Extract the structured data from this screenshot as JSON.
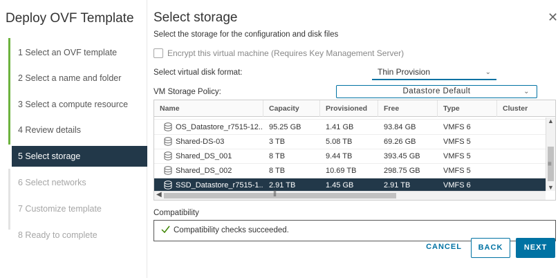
{
  "wizard": {
    "title": "Deploy OVF Template",
    "steps": [
      {
        "label": "1  Select an OVF template",
        "state": "done"
      },
      {
        "label": "2  Select a name and folder",
        "state": "done"
      },
      {
        "label": "3  Select a compute resource",
        "state": "done"
      },
      {
        "label": "4  Review details",
        "state": "done"
      },
      {
        "label": "5  Select storage",
        "state": "active"
      },
      {
        "label": "6  Select networks",
        "state": "disabled"
      },
      {
        "label": "7  Customize template",
        "state": "disabled"
      },
      {
        "label": "8  Ready to complete",
        "state": "disabled"
      }
    ]
  },
  "page": {
    "title": "Select storage",
    "subtitle": "Select the storage for the configuration and disk files",
    "close_icon": "close-icon"
  },
  "encrypt": {
    "label": "Encrypt this virtual machine (Requires Key Management Server)",
    "checked": false
  },
  "disk_format": {
    "label": "Select virtual disk format:",
    "value": "Thin Provision"
  },
  "storage_policy": {
    "label": "VM Storage Policy:",
    "value": "Datastore Default"
  },
  "grid": {
    "columns": [
      "Name",
      "Capacity",
      "Provisioned",
      "Free",
      "Type",
      "Cluster"
    ],
    "rows": [
      {
        "name": "OS_Datastore_r7515-12...",
        "capacity": "95.25 GB",
        "provisioned": "1.41 GB",
        "free": "93.84 GB",
        "type": "VMFS 6",
        "cluster": ""
      },
      {
        "name": "Shared-DS-03",
        "capacity": "3 TB",
        "provisioned": "5.08 TB",
        "free": "69.26 GB",
        "type": "VMFS 5",
        "cluster": ""
      },
      {
        "name": "Shared_DS_001",
        "capacity": "8 TB",
        "provisioned": "9.44 TB",
        "free": "393.45 GB",
        "type": "VMFS 5",
        "cluster": ""
      },
      {
        "name": "Shared_DS_002",
        "capacity": "8 TB",
        "provisioned": "10.69 TB",
        "free": "298.75 GB",
        "type": "VMFS 5",
        "cluster": ""
      },
      {
        "name": "SSD_Datastore_r7515-1...",
        "capacity": "2.91 TB",
        "provisioned": "1.45 GB",
        "free": "2.91 TB",
        "type": "VMFS 6",
        "cluster": "",
        "selected": true
      }
    ],
    "row_icon": "datastore-icon"
  },
  "compatibility": {
    "label": "Compatibility",
    "message": "Compatibility checks succeeded.",
    "icon": "check-icon"
  },
  "footer": {
    "cancel_label": "CANCEL",
    "back_label": "BACK",
    "next_label": "NEXT"
  },
  "colors": {
    "accent": "#0072a3",
    "selected_bg": "#223849",
    "done_bar": "#6db33f"
  }
}
